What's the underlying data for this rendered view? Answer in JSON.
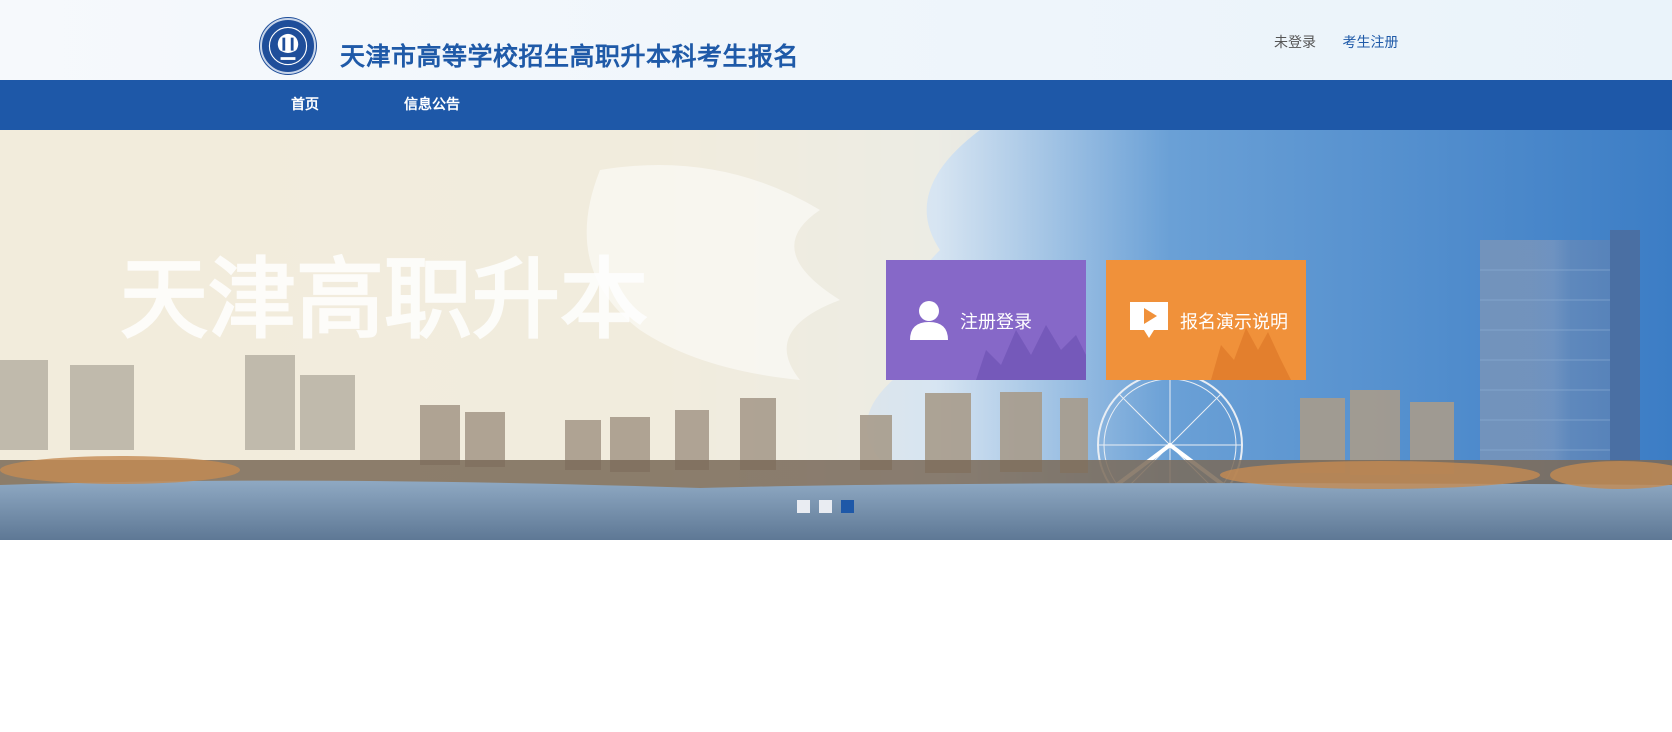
{
  "header": {
    "site_title": "天津市高等学校招生高职升本科考生报名",
    "links": {
      "login_status": "未登录",
      "register": "考生注册"
    }
  },
  "nav": {
    "items": [
      {
        "label": "首页"
      },
      {
        "label": "信息公告"
      }
    ]
  },
  "banner": {
    "calligraphy_text": "天津高职升本",
    "tiles": [
      {
        "label": "注册登录",
        "icon": "user-icon",
        "color": "#8668c8"
      },
      {
        "label": "报名演示说明",
        "icon": "play-flag-icon",
        "color": "#f0913a"
      }
    ],
    "carousel": {
      "slides": 3,
      "active_index": 3
    }
  },
  "colors": {
    "brand_blue": "#1e58a8",
    "title_blue": "#1f5aa8"
  }
}
